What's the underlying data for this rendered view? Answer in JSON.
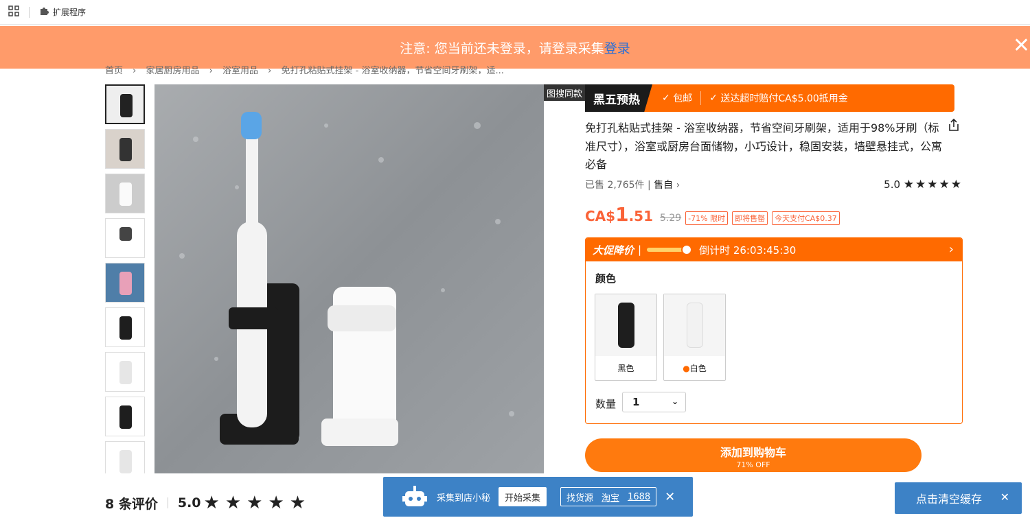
{
  "topbar": {
    "extensions_label": "扩展程序"
  },
  "notice": {
    "text": "注意: 您当前还未登录，请登录采集",
    "link": "登录"
  },
  "breadcrumb": [
    "首页",
    "›",
    "家居厨房用品",
    "›",
    "浴室用品",
    "›",
    "免打孔粘贴式挂架 - 浴室收纳器，节省空间牙刷架，适..."
  ],
  "gallery": {
    "image_search_label": "图搜同款",
    "thumb_count": 9
  },
  "promo": {
    "black_friday": "黑五预热",
    "free_shipping": "包邮",
    "late_compensation": "送达超时赔付CA$5.00抵用金"
  },
  "product": {
    "title": "免打孔粘贴式挂架 - 浴室收纳器，节省空间牙刷架，适用于98%牙刷（标准尺寸），浴室或厨房台面储物，小巧设计，稳固安装，墙壁悬挂式，公寓必备",
    "sold": "已售 2,765件",
    "seller": "售自",
    "rating_value": "5.0",
    "rating_stars": "★★★★★"
  },
  "price": {
    "currency": "CA$",
    "integer": "1",
    "decimal": ".51",
    "original": "5.29",
    "discount_tag": "-71% 限时",
    "selling_out_tag": "即将售罄",
    "pay_today_tag": "今天支付CA$0.37"
  },
  "sale": {
    "title": "大促降价",
    "countdown": "倒计时 26:03:45:30",
    "color_label": "颜色",
    "colors": [
      {
        "label": "黑色",
        "hex": "#1e1e1e"
      },
      {
        "label": "白色",
        "hex": "#f2f2f2"
      }
    ],
    "qty_label": "数量",
    "qty_value": "1"
  },
  "cart": {
    "label": "添加到购物车",
    "sub": "71% OFF"
  },
  "reviews": {
    "count_label": "8 条评价",
    "score": "5.0",
    "stars": "★★★★★"
  },
  "collector": {
    "title": "采集到店小秘",
    "start_button": "开始采集",
    "source_label": "找货源",
    "source_taobao": "淘宝",
    "source_1688": "1688"
  },
  "clear_cache": {
    "label": "点击清空缓存"
  }
}
